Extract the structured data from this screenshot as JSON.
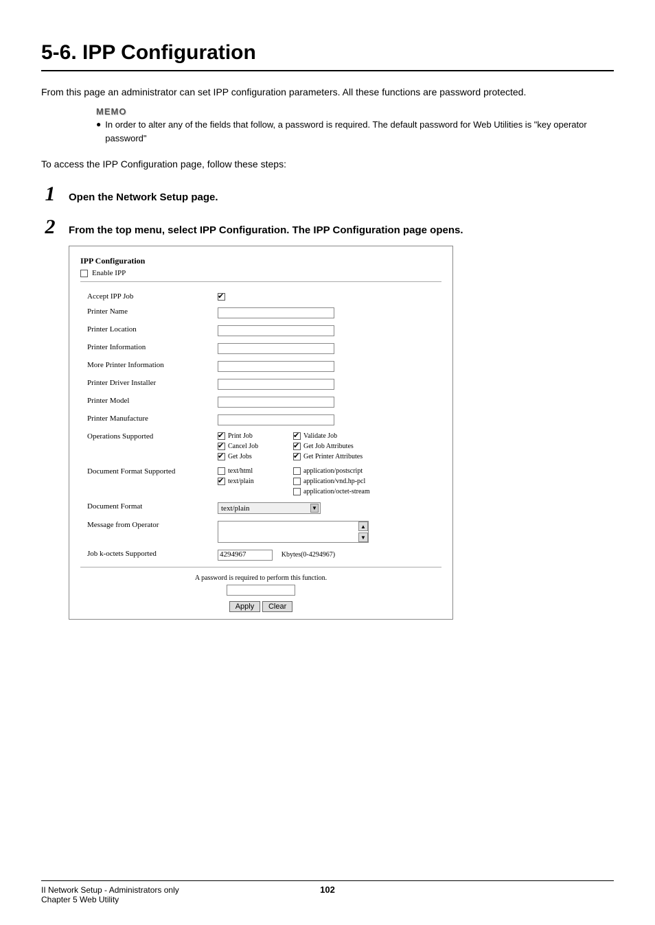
{
  "title": "5-6. IPP Configuration",
  "intro": "From this page an administrator can set IPP configuration parameters. All these functions are password protected.",
  "memo": {
    "label": "MEMO",
    "text": "In order to alter any of the fields that follow, a password is required. The default password for Web Utilities is \"key operator password\""
  },
  "access_text": "To access the IPP Configuration page, follow these steps:",
  "steps": {
    "s1": {
      "num": "1",
      "text": "Open the Network Setup page."
    },
    "s2": {
      "num": "2",
      "text": "From the top menu, select IPP Configuration. The IPP Configuration page opens."
    }
  },
  "screenshot": {
    "panel_title": "IPP Configuration",
    "enable_label": "Enable IPP",
    "rows": {
      "accept": {
        "label": "Accept IPP Job"
      },
      "printer_name": {
        "label": "Printer Name"
      },
      "printer_location": {
        "label": "Printer Location"
      },
      "printer_info": {
        "label": "Printer Information"
      },
      "more_printer_info": {
        "label": "More Printer Information"
      },
      "driver_installer": {
        "label": "Printer Driver Installer"
      },
      "printer_model": {
        "label": "Printer Model"
      },
      "printer_mfr": {
        "label": "Printer Manufacture"
      },
      "ops_supported": {
        "label": "Operations Supported"
      },
      "doc_format_supported": {
        "label": "Document Format Supported"
      },
      "doc_format": {
        "label": "Document Format"
      },
      "msg_operator": {
        "label": "Message from Operator"
      },
      "job_koctets": {
        "label": "Job k-octets Supported"
      }
    },
    "ops": {
      "print_job": "Print Job",
      "validate_job": "Validate Job",
      "cancel_job": "Cancel Job",
      "get_job_attr": "Get Job Attributes",
      "get_jobs": "Get Jobs",
      "get_printer_attr": "Get Printer Attributes"
    },
    "formats": {
      "text_html": "text/html",
      "app_postscript": "application/postscript",
      "text_plain": "text/plain",
      "app_vnd_hp_pcl": "application/vnd.hp-pcl",
      "app_octet": "application/octet-stream"
    },
    "doc_format_selected": "text/plain",
    "job_koctets_value": "4294967",
    "job_koctets_unit": "Kbytes(0-4294967)",
    "password_note": "A password is required to perform this function.",
    "buttons": {
      "apply": "Apply",
      "clear": "Clear"
    }
  },
  "footer": {
    "line1": "II Network Setup - Administrators only",
    "line2": "Chapter 5 Web Utility",
    "page": "102"
  }
}
